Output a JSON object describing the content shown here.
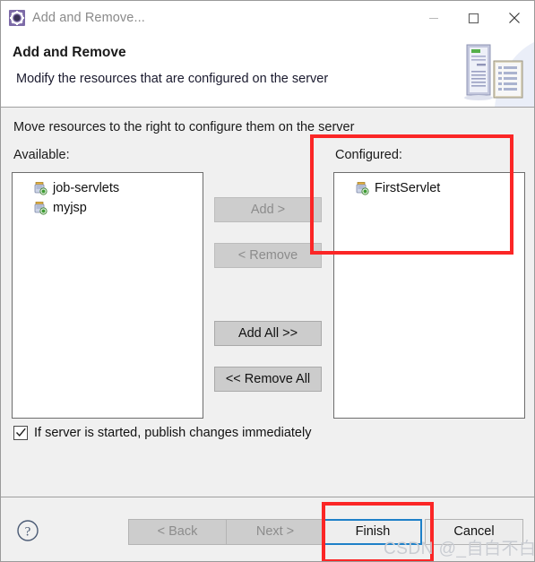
{
  "window": {
    "title": "Add and Remove...",
    "icon": "server-gear-icon",
    "controls": {
      "minimize": "minimize-icon",
      "maximize": "maximize-icon",
      "close": "close-icon"
    }
  },
  "header": {
    "title": "Add and Remove",
    "subtitle": "Modify the resources that are configured on the server",
    "banner_icon": "server-and-document-icon"
  },
  "body": {
    "instruction": "Move resources to the right to configure them on the server",
    "available": {
      "label": "Available:",
      "items": [
        {
          "name": "job-servlets",
          "icon": "web-module-icon"
        },
        {
          "name": "myjsp",
          "icon": "web-module-icon"
        }
      ]
    },
    "configured": {
      "label": "Configured:",
      "items": [
        {
          "name": "FirstServlet",
          "icon": "web-module-icon"
        }
      ]
    },
    "transfer_buttons": [
      {
        "id": "add",
        "label": "Add >",
        "enabled": false
      },
      {
        "id": "remove",
        "label": "< Remove",
        "enabled": false
      },
      {
        "id": "add-all",
        "label": "Add All >>",
        "enabled": true
      },
      {
        "id": "remove-all",
        "label": "<< Remove All",
        "enabled": true
      }
    ],
    "publish_checkbox": {
      "label": "If server is started, publish changes immediately",
      "checked": true
    }
  },
  "footer": {
    "help_icon": "help-question-icon",
    "buttons": [
      {
        "id": "back",
        "label": "< Back",
        "enabled": false
      },
      {
        "id": "next",
        "label": "Next >",
        "enabled": false
      },
      {
        "id": "finish",
        "label": "Finish",
        "enabled": true,
        "focused": true
      },
      {
        "id": "cancel",
        "label": "Cancel",
        "enabled": true
      }
    ]
  },
  "annotations": {
    "highlight_color": "#fb2626",
    "regions": [
      "configured-panel",
      "finish-button"
    ]
  },
  "watermark": {
    "text": "CSDN @_自白不白"
  }
}
